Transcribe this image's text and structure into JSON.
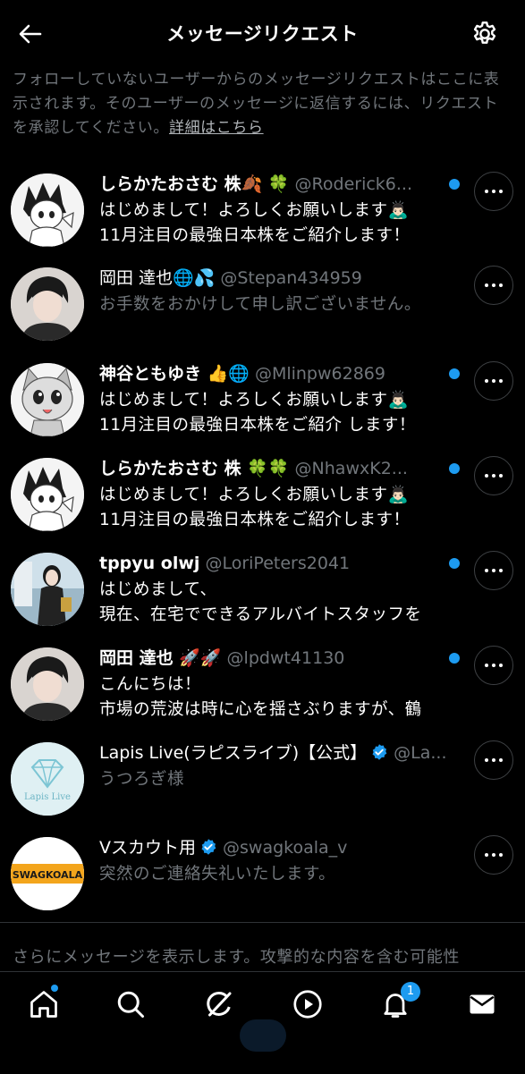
{
  "header": {
    "title": "メッセージリクエスト",
    "back_icon": "arrow-left-icon",
    "settings_icon": "gear-icon"
  },
  "intro": {
    "text": "フォローしていないユーザーからのメッセージリクエストはここに表示されます。そのユーザーのメッセージに返信するには、リクエストを承認してください。",
    "link": "詳細はこちら"
  },
  "requests": [
    {
      "name": "しらかたおさむ 株🍂 🍀",
      "handle": "@Roderick6...",
      "line1": "はじめまして！よろしくお願いします🙇🏻‍♂️",
      "line2": "11月注目の最強日本株をご紹介します！",
      "unread": true,
      "avatar": "anime-cat-boy"
    },
    {
      "name": "岡田 達也🌐💦",
      "handle": "@Stepan434959",
      "line1": "お手数をおかけして申し訳ございません。",
      "line2": "",
      "unread": false,
      "avatar": "dark-haired-man"
    },
    {
      "name": "神谷ともゆき 👍🌐",
      "handle": "@Mlinpw62869",
      "line1": "はじめまして！よろしくお願いします🙇🏻‍♂️",
      "line2": "11月注目の最強日本株をご紹介 します！",
      "unread": true,
      "avatar": "cartoon-cat"
    },
    {
      "name": "しらかたおさむ 株 🍀🍀",
      "handle": "@NhawxK2...",
      "line1": "はじめまして！よろしくお願いします🙇🏻‍♂️",
      "line2": "11月注目の最強日本株をご紹介します！",
      "unread": true,
      "avatar": "anime-cat-boy"
    },
    {
      "name": "tppyu olwj",
      "handle": "@LoriPeters2041",
      "line1": "はじめまして、",
      "line2": "現在、在宅でできるアルバイトスタッフを",
      "unread": true,
      "avatar": "woman-photo"
    },
    {
      "name": "岡田 達也 🚀🚀",
      "handle": "@lpdwt41130",
      "line1": "こんにちは！",
      "line2": "市場の荒波は時に心を揺さぶりますが、鶴",
      "unread": true,
      "avatar": "dark-haired-man"
    },
    {
      "name": "Lapis Live(ラピスライブ)【公式】",
      "handle": "@La...",
      "line1": "うつろぎ様",
      "line2": "",
      "unread": false,
      "verified": true,
      "avatar": "lapis-live-logo"
    },
    {
      "name": "Vスカウト用",
      "handle": "@swagkoala_v",
      "line1": "突然のご連絡失礼いたします。",
      "line2": "",
      "unread": false,
      "verified": true,
      "avatar": "swagkoala-logo"
    }
  ],
  "lapis_logo_text": "Lapis Live",
  "swag_logo_text": "SWAGKOALA",
  "footer": {
    "more_text": "さらにメッセージを表示します。攻撃的な内容を含む可能性"
  },
  "tabbar": {
    "items": [
      "home-icon",
      "search-icon",
      "grok-icon",
      "play-icon",
      "bell-icon",
      "mail-icon"
    ],
    "notification_badge": "1"
  },
  "colors": {
    "accent": "#1d9bf0",
    "background": "#000000",
    "muted": "#71767b"
  }
}
